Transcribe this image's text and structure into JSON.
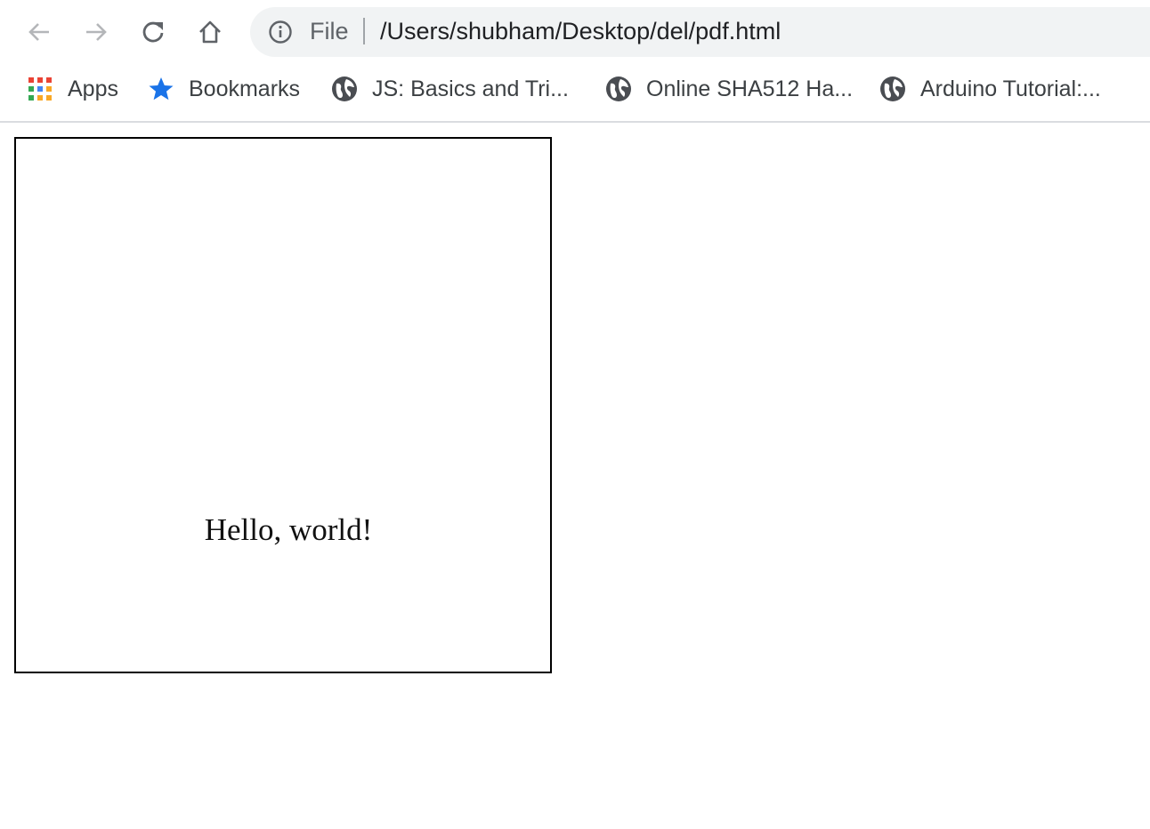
{
  "browser": {
    "nav": {
      "back_icon": "arrow-left-icon",
      "forward_icon": "arrow-right-icon",
      "reload_icon": "reload-icon",
      "home_icon": "home-icon"
    },
    "omnibox": {
      "info_icon": "info-icon",
      "scheme": "File",
      "url": "/Users/shubham/Desktop/del/pdf.html"
    },
    "bookmarks": [
      {
        "label": "Apps",
        "icon": "apps-grid-icon"
      },
      {
        "label": "Bookmarks",
        "icon": "star-icon"
      },
      {
        "label": "JS: Basics and Tri...",
        "icon": "globe-icon"
      },
      {
        "label": "Online SHA512 Ha...",
        "icon": "globe-icon"
      },
      {
        "label": "Arduino Tutorial:...",
        "icon": "globe-icon"
      }
    ],
    "colors": {
      "star": "#1a73e8",
      "apps_red": "#ea4335",
      "apps_blue": "#4285f4",
      "apps_green": "#34a853",
      "apps_yellow": "#f9a825"
    }
  },
  "page": {
    "document_text": "Hello, world!"
  }
}
